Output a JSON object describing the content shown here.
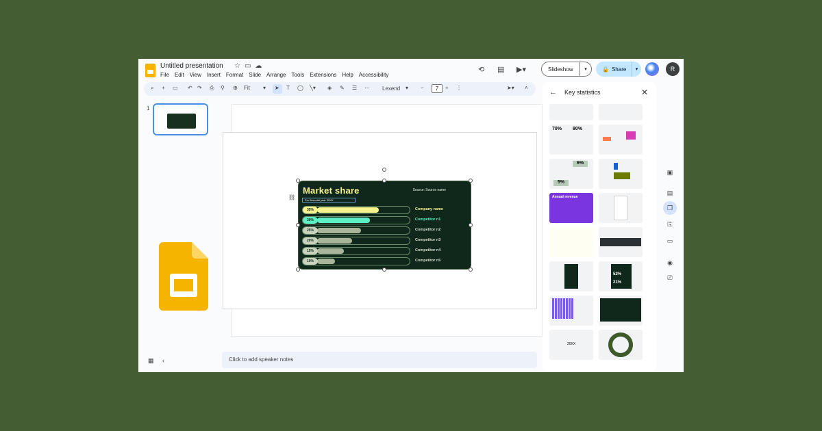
{
  "app": {
    "doc_title": "Untitled presentation",
    "menu": [
      "File",
      "Edit",
      "View",
      "Insert",
      "Format",
      "Slide",
      "Arrange",
      "Tools",
      "Extensions",
      "Help",
      "Accessibility"
    ],
    "slideshow_label": "Slideshow",
    "share_label": "Share",
    "avatar_letter": "R"
  },
  "toolbar": {
    "zoom": "Fit",
    "font": "Lexend",
    "font_size": "7"
  },
  "filmstrip": {
    "slide_number": "1"
  },
  "slide": {
    "title": "Market share",
    "source": "Source: Source name",
    "subtitle": "For financial year 20XX",
    "rows": [
      {
        "pct": "35%",
        "label": "Company name",
        "value": 0.35,
        "color": "#f7f38e",
        "label_color": "#f7f38e"
      },
      {
        "pct": "30%",
        "label": "Competitor n1",
        "value": 0.3,
        "color": "#5cf0c4",
        "label_color": "#5cf0c4"
      },
      {
        "pct": "25%",
        "label": "Competitor n2",
        "value": 0.25,
        "color": "#a9b59a",
        "label_color": "#d7dfd0"
      },
      {
        "pct": "20%",
        "label": "Competitor n3",
        "value": 0.2,
        "color": "#a9b59a",
        "label_color": "#d7dfd0"
      },
      {
        "pct": "15%",
        "label": "Competitor n4",
        "value": 0.15,
        "color": "#a9b59a",
        "label_color": "#d7dfd0"
      },
      {
        "pct": "10%",
        "label": "Competitor n5",
        "value": 0.1,
        "color": "#a9b59a",
        "label_color": "#d7dfd0"
      }
    ]
  },
  "speaker_notes": {
    "placeholder": "Click to add speaker notes"
  },
  "side_panel": {
    "title": "Key statistics",
    "templates": [
      {
        "text1": "70%",
        "text2": "80%"
      },
      {
        "text1": "6%",
        "text2": "5%"
      },
      {
        "text1": "Annual revenue"
      },
      {
        "text1": "52%",
        "text2": "21%"
      },
      {
        "text1": "20XX"
      }
    ]
  }
}
